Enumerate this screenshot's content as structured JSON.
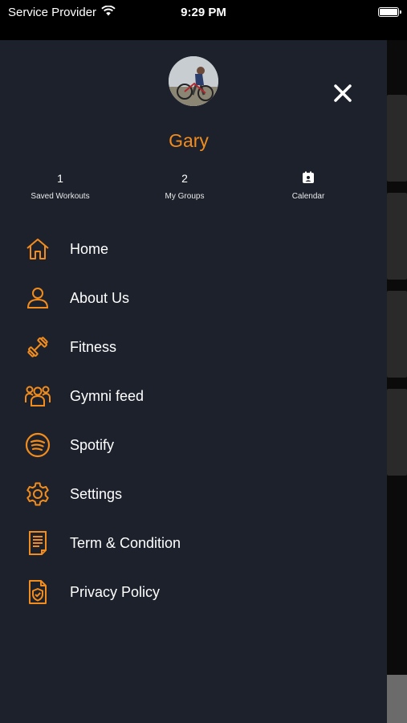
{
  "status_bar": {
    "carrier": "Service Provider",
    "time": "9:29 PM"
  },
  "profile": {
    "name": "Gary"
  },
  "stats": [
    {
      "value": "1",
      "label": "Saved Workouts"
    },
    {
      "value": "2",
      "label": "My Groups"
    },
    {
      "value": "",
      "label": "Calendar"
    }
  ],
  "menu": [
    {
      "label": "Home",
      "icon": "home-icon"
    },
    {
      "label": "About Us",
      "icon": "user-icon"
    },
    {
      "label": "Fitness",
      "icon": "dumbbell-icon"
    },
    {
      "label": "Gymni feed",
      "icon": "group-icon"
    },
    {
      "label": "Spotify",
      "icon": "spotify-icon"
    },
    {
      "label": "Settings",
      "icon": "gear-icon"
    },
    {
      "label": "Term & Condition",
      "icon": "document-icon"
    },
    {
      "label": "Privacy Policy",
      "icon": "shield-document-icon"
    }
  ],
  "colors": {
    "accent": "#f28c1c",
    "drawer_bg": "#1d212c"
  }
}
